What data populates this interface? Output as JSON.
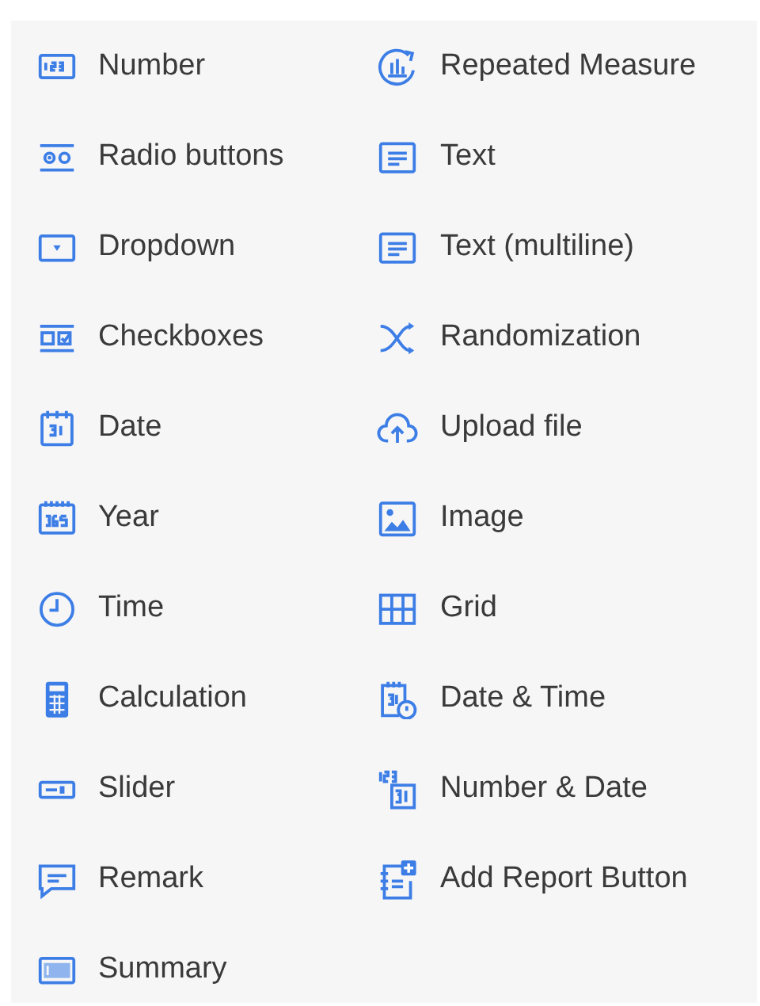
{
  "field_types": {
    "left_column": [
      {
        "label": "Number",
        "kind": "number"
      },
      {
        "label": "Radio buttons",
        "kind": "radio"
      },
      {
        "label": "Dropdown",
        "kind": "dropdown"
      },
      {
        "label": "Checkboxes",
        "kind": "checkboxes"
      },
      {
        "label": "Date",
        "kind": "date"
      },
      {
        "label": "Year",
        "kind": "year"
      },
      {
        "label": "Time",
        "kind": "time"
      },
      {
        "label": "Calculation",
        "kind": "calculation"
      },
      {
        "label": "Slider",
        "kind": "slider"
      },
      {
        "label": "Remark",
        "kind": "remark"
      },
      {
        "label": "Summary",
        "kind": "summary"
      }
    ],
    "right_column": [
      {
        "label": "Repeated Measure",
        "kind": "repeat"
      },
      {
        "label": "Text",
        "kind": "text"
      },
      {
        "label": "Text (multiline)",
        "kind": "text"
      },
      {
        "label": "Randomization",
        "kind": "shuffle"
      },
      {
        "label": "Upload file",
        "kind": "upload"
      },
      {
        "label": "Image",
        "kind": "image"
      },
      {
        "label": "Grid",
        "kind": "grid"
      },
      {
        "label": "Date & Time",
        "kind": "datetime"
      },
      {
        "label": "Number & Date",
        "kind": "numberdate"
      },
      {
        "label": "Add Report Button",
        "kind": "report"
      }
    ]
  }
}
